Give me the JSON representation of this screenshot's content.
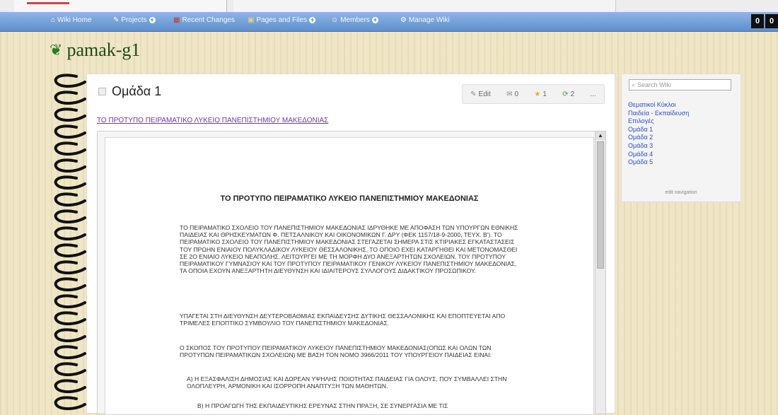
{
  "navbar": {
    "items": [
      {
        "label": "Wiki Home",
        "icon": "home-icon",
        "plus": false
      },
      {
        "label": "Projects",
        "icon": "projects-icon",
        "plus": true
      },
      {
        "label": "Recent Changes",
        "icon": "calendar-icon",
        "plus": false
      },
      {
        "label": "Pages and Files",
        "icon": "pages-icon",
        "plus": true
      },
      {
        "label": "Members",
        "icon": "members-icon",
        "plus": true
      },
      {
        "label": "Manage Wiki",
        "icon": "gear-icon",
        "plus": false
      }
    ]
  },
  "site": {
    "title": "pamak-g1"
  },
  "page": {
    "title": "Ομάδα 1",
    "actions": {
      "edit": "Edit",
      "comments": "0",
      "tags": "1",
      "revisions": "2",
      "more": "..."
    },
    "link": "ΤΟ ΠΡΟΤΥΠΟ ΠΕΙΡΑΜΑΤΙΚΟ ΛΥΚΕΙΟ ΠΑΝΕΠΙΣΤΗΜΙΟΥ ΜΑΚΕΔΟΝΙΑΣ"
  },
  "document": {
    "title": "ΤΟ ΠΡΟΤΥΠΟ ΠΕΙΡΑΜΑΤΙΚΟ ΛΥΚΕΙΟ ΠΑΝΕΠΙΣΤΗΜΙΟΥ ΜΑΚΕΔΟΝΙΑΣ",
    "paragraphs": [
      "ΤΟ ΠΕΙΡΑΜΑΤΙΚΟ ΣΧΟΛΕΙΟ ΤΟΥ ΠΑΝΕΠΙΣΤΗΜΙΟΥ ΜΑΚΕΔΟΝΙΑΣ ΙΔΡΥΘΗΚΕ ΜΕ ΑΠΟΦΑΣΗ ΤΩΝ ΥΠΟΥΡΓΩΝ ΕΘΝΙΚΗΣ ΠΑΙΔΕΙΑΣ ΚΑΙ ΘΡΗΣΚΕΥΜΑΤΩΝ Φ. ΠΕΤΣΑΛΝΙΚΟΥ ΚΑΙ ΟΙΚΟΝΟΜΙΚΩΝ Γ. ΔΡΥ (ΦΕΚ 1157/18-9-2000, ΤΕΥΧ. Β'). ΤΟ ΠΕΙΡΑΜΑΤΙΚΟ ΣΧΟΛΕΙΟ ΤΟΥ ΠΑΝΕΠΙΣΤΗΜΙΟΥ ΜΑΚΕΔΟΝΙΑΣ ΣΤΕΓΑΖΕΤΑΙ ΣΗΜΕΡΑ ΣΤΙΣ ΚΤΙΡΙΑΚΕΣ ΕΓΚΑΤΑΣΤΑΣΕΙΣ ΤΟΥ ΠΡΩΗΝ ΕΝΙΑΙΟΥ ΠΟΛΥΚΛΑΔΙΚΟΥ ΛΥΚΕΙΟΥ ΘΕΣΣΑΛΟΝΙΚΗΣ, ΤΟ ΟΠΟΙΟ ΕΧΕΙ ΚΑΤΑΡΓΗΘΕΙ ΚΑΙ ΜΕΤΟΝΟΜΑΣΘΕΙ ΣΕ 2Ο ΕΝΙΑΙΟ ΛΥΚΕΙΟ ΝΕΑΠΟΛΗΣ. ΛΕΙΤΟΥΡΓΕΙ ΜΕ ΤΗ ΜΟΡΦΗ ΔΥΟ ΑΝΕΞΑΡΤΗΤΩΝ ΣΧΟΛΕΙΩΝ, ΤΟΥ ΠΡΟΤΥΠΟΥ ΠΕΙΡΑΜΑΤΙΚΟΥ ΓΥΜΝΑΣΙΟΥ ΚΑΙ ΤΟΥ ΠΡΟΤΥΠΟΥ ΠΕΙΡΑΜΑΤΙΚΟΥ ΓΕΝΙΚΟΥ ΛΥΚΕΙΟΥ ΠΑΝΕΠΙΣΤΗΜΙΟΥ ΜΑΚΕΔΟΝΙΑΣ, ΤΑ ΟΠΟΙΑ ΕΧΟΥΝ ΑΝΕΞΑΡΤΗΤΗ ΔΙΕΥΘΥΝΣΗ ΚΑΙ ΙΔΙΑΙΤΕΡΟΥΣ ΣΥΛΛΟΓΟΥΣ ΔΙΔΑΚΤΙΚΟΥ ΠΡΟΣΩΠΙΚΟΥ.",
      "ΥΠΑΓΕΤΑΙ ΣΤΗ ΔΙΕΥΘΥΝΣΗ ΔΕΥΤΕΡΟΒΑΘΜΙΑΣ ΕΚΠΑΙΔΕΥΣΗΣ ΔΥΤΙΚΗΣ ΘΕΣΣΑΛΟΝΙΚΗΣ ΚΑΙ ΕΠΟΠΤΕΥΕΤΑΙ ΑΠΟ ΤΡΙΜΕΛΕΣ ΕΠΟΠΤΙΚΟ ΣΥΜΒΟΥΛΙΟ ΤΟΥ ΠΑΝΕΠΙΣΤΗΜΙΟΥ ΜΑΚΕΔΟΝΙΑΣ.",
      "Ο ΣΚΟΠΟΣ ΤΟΥ ΠΡΟΤΥΠΟΥ ΠΕΙΡΑΜΑΤΙΚΟΥ ΛΥΚΕΙΟΥ ΠΑΝΕΠΙΣΤΗΜΙΟΥ ΜΑΚΕΔΟΝΙΑΣ(ΟΠΩΣ ΚΑΙ ΟΛΩΝ ΤΩΝ ΠΡΟΤΥΠΩΝ ΠΕΙΡΑΜΑΤΙΚΩΝ ΣΧΟΛΕΙΩΝ) ΜΕ ΒΑΣΗ ΤΟΝ ΝΟΜΟ 3966/2011 ΤΟΥ ΥΠΟΥΡΓΕΙΟΥ ΠΑΙΔΕΙΑΣ ΕΙΝΑΙ:",
      "Α) Η ΕΞΑΣΦΑΛΙΣΗ ΔΗΜΟΣΙΑΣ ΚΑΙ ΔΩΡΕΑΝ ΥΨΗΛΗΣ ΠΟΙΟΤΗΤΑΣ ΠΑΙΔΕΙΑΣ ΓΙΑ ΟΛΟΥΣ, ΠΟΥ ΣΥΜΒΑΛΛΕΙ ΣΤΗΝ ΟΛΟΠΛΕΥΡΗ, ΑΡΜΟΝΙΚΗ ΚΑΙ ΙΣΟΡΡΟΠΗ ΑΝΑΠΤΥΞΗ ΤΩΝ ΜΑΘΗΤΩΝ.",
      "Β) Η ΠΡΟΑΓΩΓΗ ΤΗΣ ΕΚΠΑΙΔΕΥΤΙΚΗΣ ΕΡΕΥΝΑΣ ΣΤΗΝ ΠΡΑΞΗ, ΣΕ ΣΥΝΕΡΓΑΣΙΑ ΜΕ ΤΙΣ"
    ]
  },
  "sidebar": {
    "search_placeholder": "Search Wiki",
    "links": [
      "Θεματικοί Κύκλοι",
      "Παιδεία - Εκπαίδευση",
      "Επιλογές",
      "Ομάδα 1",
      "Ομάδα 2",
      "Ομάδα 3",
      "Ομάδα 4",
      "Ομάδα 5"
    ],
    "edit_navigation": "edit navigation"
  },
  "window": {
    "buttons": [
      "0",
      "0"
    ]
  },
  "colors": {
    "navbar": "#6f9ed8",
    "link": "#6b38a8",
    "sidebar_link": "#2a4fc3",
    "background": "#efe6c6"
  }
}
